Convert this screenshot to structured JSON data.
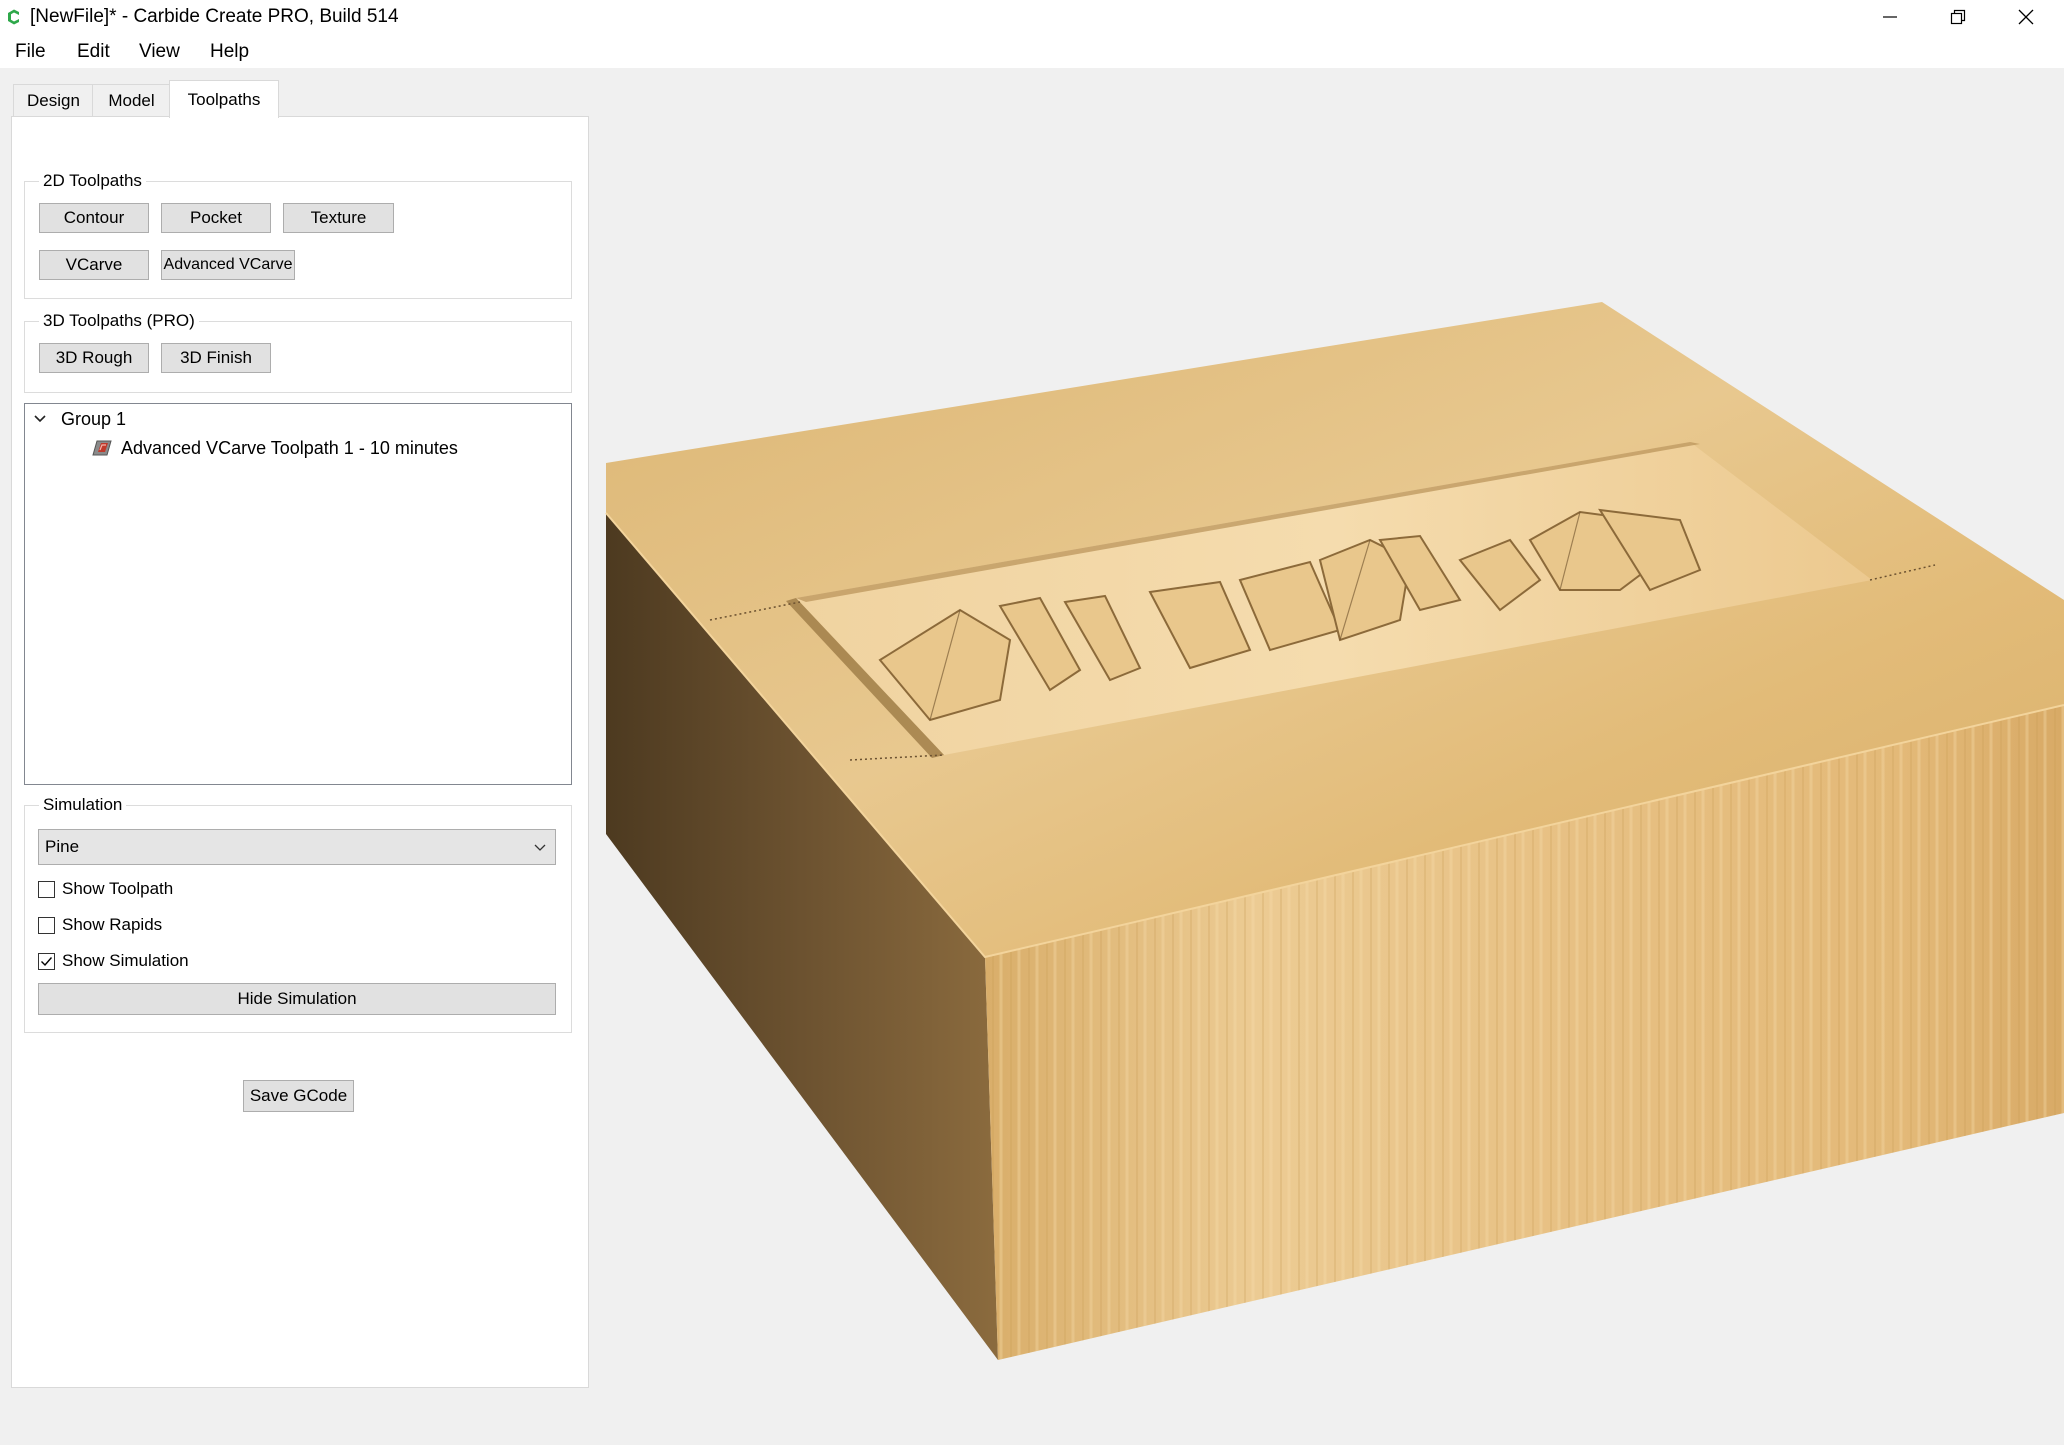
{
  "window": {
    "title": "[NewFile]* - Carbide Create PRO, Build 514"
  },
  "menu": {
    "items": [
      "File",
      "Edit",
      "View",
      "Help"
    ]
  },
  "tabs": [
    {
      "label": "Design",
      "active": false
    },
    {
      "label": "Model",
      "active": false
    },
    {
      "label": "Toolpaths",
      "active": true
    }
  ],
  "toolpaths2d": {
    "title": "2D Toolpaths",
    "contour": "Contour",
    "pocket": "Pocket",
    "texture": "Texture",
    "vcarve": "VCarve",
    "advanced_vcarve": "Advanced VCarve"
  },
  "toolpaths3d": {
    "title": "3D Toolpaths (PRO)",
    "rough": "3D Rough",
    "finish": "3D Finish"
  },
  "toolpath_tree": {
    "group_label": "Group 1",
    "items": [
      "Advanced VCarve Toolpath 1 - 10 minutes"
    ]
  },
  "simulation": {
    "title": "Simulation",
    "material": "Pine",
    "show_toolpath": {
      "label": "Show Toolpath",
      "checked": false
    },
    "show_rapids": {
      "label": "Show Rapids",
      "checked": false
    },
    "show_simulation": {
      "label": "Show Simulation",
      "checked": true
    },
    "hide_button": "Hide Simulation"
  },
  "save_gcode": "Save GCode",
  "colors": {
    "wood_top": "#e2bd7e",
    "wood_front": "#e6c085",
    "wood_side": "#6e5330",
    "background": "#f0f0f0",
    "app_icon": "#2ea84a"
  },
  "icons": {
    "app": "carbide-create-icon",
    "toolpath": "vcarve-toolpath-icon",
    "expand": "chevron-down-icon",
    "select": "chevron-down-icon"
  }
}
